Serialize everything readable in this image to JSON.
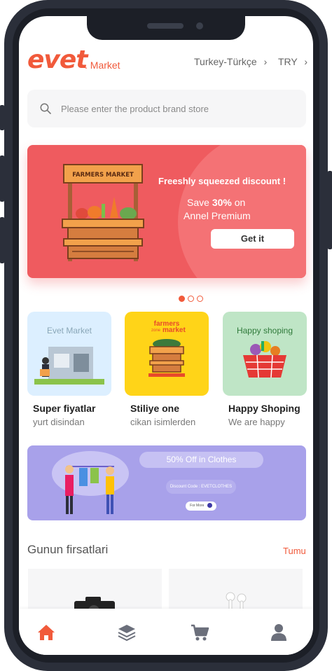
{
  "header": {
    "logo_text": "evet",
    "logo_sub": ". Market",
    "locale": "Turkey-Türkçe",
    "currency": "TRY"
  },
  "search": {
    "placeholder": "Please enter the product  brand  store"
  },
  "banner": {
    "sign": "FARMERS MARKET",
    "title": "Freeshly squeezed discount !",
    "line1_prefix": "Save ",
    "line1_bold": "30%",
    "line1_suffix": " on",
    "line2": "Annel Premium",
    "button": "Get it"
  },
  "carousel": {
    "count": 3,
    "active": 0
  },
  "categories": [
    {
      "tile_text": "Evet Market",
      "title": "Super fiyatlar",
      "subtitle": "yurt disindan",
      "bg": "#dcefff"
    },
    {
      "tile_text_top": "farmers",
      "tile_text_mid": "zone",
      "tile_text_bottom": "market",
      "title": "Stiliye one",
      "subtitle": "cikan isimlerden",
      "bg": "#ffd418"
    },
    {
      "tile_text": "Happy shoping",
      "title": "Happy Shoping",
      "subtitle": "We are happy",
      "bg": "#bfe5c6"
    }
  ],
  "promo": {
    "headline": "50% Off in Clothes",
    "code": "Discount Code : EVETCLOTHES",
    "more": "For More"
  },
  "deals": {
    "title": "Gunun firsatlari",
    "link": "Tumu"
  },
  "tabbar": {
    "items": [
      "home-icon",
      "layers-icon",
      "cart-icon",
      "user-icon"
    ]
  },
  "colors": {
    "accent": "#f15a3b",
    "banner": "#ef5b5f",
    "promo": "#a8a1ea",
    "inactive_icon": "#6b6f7b"
  }
}
